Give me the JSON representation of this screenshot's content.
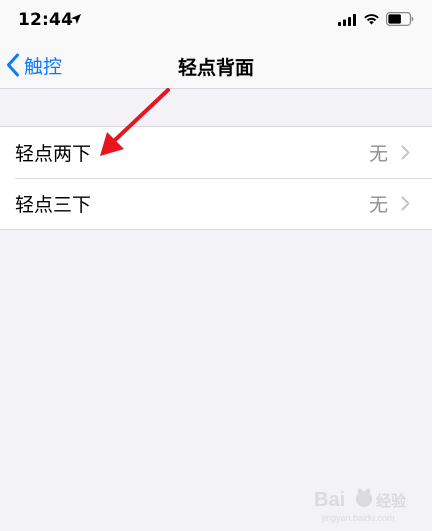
{
  "status_bar": {
    "time": "12:44",
    "icons": [
      "location-arrow-icon",
      "signal-icon",
      "wifi-icon",
      "battery-icon"
    ]
  },
  "nav": {
    "back_label": "触控",
    "title": "轻点背面"
  },
  "list": {
    "items": [
      {
        "label": "轻点两下",
        "value": "无"
      },
      {
        "label": "轻点三下",
        "value": "无"
      }
    ]
  },
  "colors": {
    "accent": "#0a7aff",
    "background": "#f2f2f7",
    "secondary_text": "#8e8e93",
    "annotation_arrow": "#e8141e"
  }
}
